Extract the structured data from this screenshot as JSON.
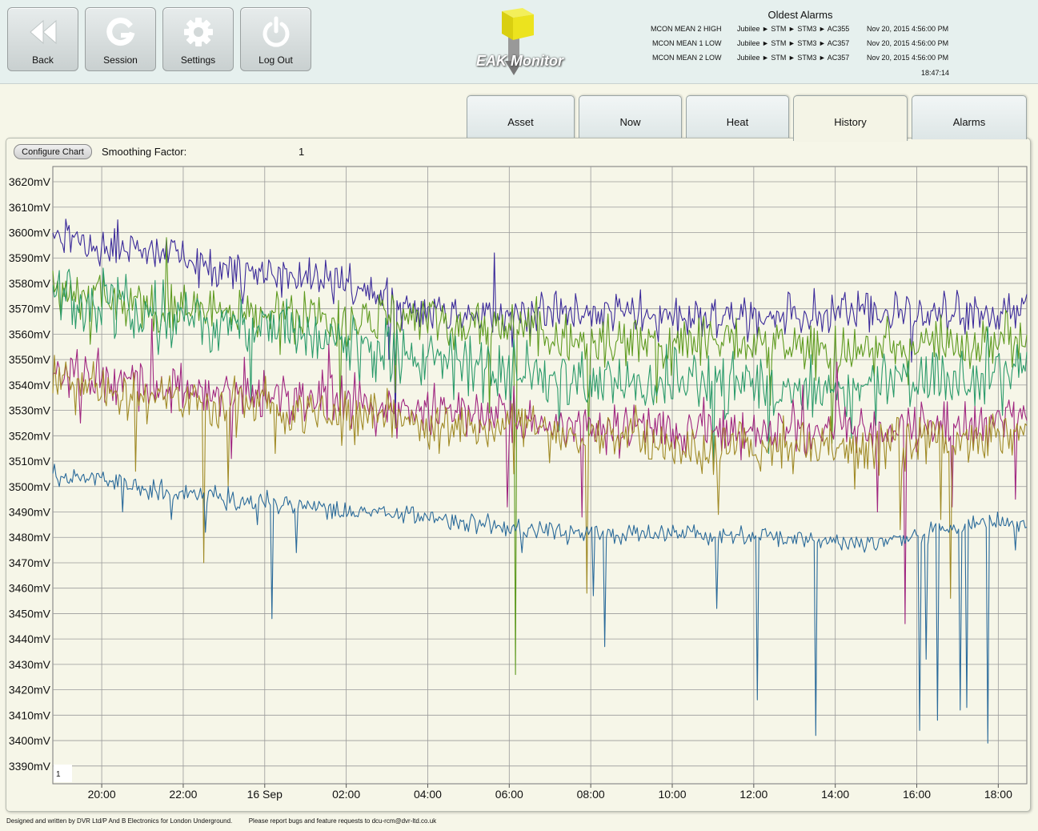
{
  "toolbar": {
    "back_label": "Back",
    "session_label": "Session",
    "settings_label": "Settings",
    "logout_label": "Log Out"
  },
  "logo": {
    "text": "EAK Monitor"
  },
  "alarms": {
    "title": "Oldest Alarms",
    "rows": [
      {
        "name": "MCON MEAN 2 HIGH",
        "path": "Jubilee ► STM ► STM3 ► AC355",
        "time": "Nov 20, 2015 4:56:00 PM"
      },
      {
        "name": "MCON MEAN 1 LOW",
        "path": "Jubilee ► STM ► STM3 ► AC357",
        "time": "Nov 20, 2015 4:56:00 PM"
      },
      {
        "name": "MCON MEAN 2 LOW",
        "path": "Jubilee ► STM ► STM3 ► AC357",
        "time": "Nov 20, 2015 4:56:00 PM"
      }
    ],
    "clock": "18:47:14"
  },
  "tabs": [
    {
      "label": "Asset"
    },
    {
      "label": "Now"
    },
    {
      "label": "Heat"
    },
    {
      "label": "History",
      "active": true
    },
    {
      "label": "Alarms"
    }
  ],
  "controls": {
    "configure_label": "Configure Chart",
    "smoothing_label": "Smoothing Factor:",
    "smoothing_value": "1"
  },
  "chart_data": {
    "type": "line",
    "y_unit": "mV",
    "ylim": [
      3383,
      3626
    ],
    "y_ticks": [
      "3620mV",
      "3610mV",
      "3600mV",
      "3590mV",
      "3580mV",
      "3570mV",
      "3560mV",
      "3550mV",
      "3540mV",
      "3530mV",
      "3520mV",
      "3510mV",
      "3500mV",
      "3490mV",
      "3480mV",
      "3470mV",
      "3460mV",
      "3450mV",
      "3440mV",
      "3430mV",
      "3420mV",
      "3410mV",
      "3400mV",
      "3390mV"
    ],
    "x_start": "18:48",
    "x_end": "18:42",
    "x_ticks": [
      "20:00",
      "22:00",
      "16 Sep",
      "02:00",
      "04:00",
      "06:00",
      "08:00",
      "10:00",
      "12:00",
      "14:00",
      "16:00",
      "18:00"
    ],
    "grid": true,
    "corner_label": "1",
    "colors": [
      "#3b2a9a",
      "#5e9a1f",
      "#2a9a6a",
      "#a02680",
      "#a08a26",
      "#2a6a9a"
    ],
    "series": [
      {
        "keypoints": [
          [
            0,
            3598
          ],
          [
            3,
            3595
          ],
          [
            6,
            3592
          ],
          [
            9,
            3588
          ],
          [
            12,
            3585
          ],
          [
            15,
            3583
          ],
          [
            18,
            3579
          ],
          [
            20,
            3574
          ],
          [
            22,
            3571
          ],
          [
            26,
            3568
          ],
          [
            30,
            3568
          ],
          [
            34,
            3568
          ],
          [
            38,
            3567
          ],
          [
            42,
            3567
          ],
          [
            46,
            3568
          ],
          [
            50,
            3568
          ],
          [
            54,
            3568
          ],
          [
            60,
            3568
          ]
        ],
        "noise": 4,
        "spikes": [
          [
            4,
            3605
          ],
          [
            8.5,
            3589
          ],
          [
            11.7,
            3572
          ],
          [
            14.5,
            3578
          ],
          [
            15.6,
            3585
          ],
          [
            20.7,
            3550
          ],
          [
            21.1,
            3523
          ],
          [
            23.0,
            3565
          ],
          [
            24.1,
            3572
          ],
          [
            27.2,
            3592
          ],
          [
            28.3,
            3555
          ],
          [
            31.3,
            3574
          ],
          [
            32.1,
            3563
          ],
          [
            34.9,
            3574
          ],
          [
            37.3,
            3557
          ],
          [
            42.8,
            3557
          ],
          [
            47.4,
            3561
          ],
          [
            52.9,
            3549
          ],
          [
            56.2,
            3560
          ]
        ]
      },
      {
        "keypoints": [
          [
            0,
            3577
          ],
          [
            5,
            3573
          ],
          [
            10,
            3568
          ],
          [
            15,
            3566
          ],
          [
            20,
            3565
          ],
          [
            25,
            3564
          ],
          [
            30,
            3561
          ],
          [
            32,
            3558
          ],
          [
            35,
            3557
          ],
          [
            40,
            3556
          ],
          [
            45,
            3555
          ],
          [
            50,
            3554
          ],
          [
            55,
            3556
          ],
          [
            60,
            3557
          ]
        ],
        "noise": 5,
        "spikes": [
          [
            2.3,
            3556
          ],
          [
            7.0,
            3598
          ],
          [
            9.7,
            3577
          ],
          [
            14.0,
            3552
          ],
          [
            17.7,
            3528
          ],
          [
            21.1,
            3537
          ],
          [
            23.4,
            3573
          ],
          [
            26.9,
            3529
          ],
          [
            28.5,
            3426
          ],
          [
            33.0,
            3520
          ],
          [
            37.2,
            3533
          ],
          [
            44.2,
            3532
          ],
          [
            48.0,
            3517
          ],
          [
            52.7,
            3540
          ],
          [
            58.8,
            3568
          ]
        ]
      },
      {
        "keypoints": [
          [
            0,
            3575
          ],
          [
            5,
            3570
          ],
          [
            10,
            3565
          ],
          [
            15,
            3560
          ],
          [
            18,
            3555
          ],
          [
            20,
            3552
          ],
          [
            25,
            3548
          ],
          [
            30,
            3543
          ],
          [
            35,
            3541
          ],
          [
            40,
            3540
          ],
          [
            45,
            3539
          ],
          [
            50,
            3540
          ],
          [
            55,
            3542
          ],
          [
            60,
            3546
          ]
        ],
        "noise": 6,
        "spikes": [
          [
            6.5,
            3552
          ],
          [
            12.2,
            3534
          ],
          [
            17.1,
            3564
          ],
          [
            18.9,
            3540
          ],
          [
            26.5,
            3533
          ],
          [
            31.2,
            3522
          ],
          [
            37.8,
            3556
          ],
          [
            40.7,
            3506
          ],
          [
            44.1,
            3513
          ],
          [
            49.2,
            3519
          ],
          [
            53.5,
            3551
          ],
          [
            57.6,
            3563
          ]
        ]
      },
      {
        "keypoints": [
          [
            0,
            3545
          ],
          [
            5,
            3541
          ],
          [
            10,
            3538
          ],
          [
            15,
            3535
          ],
          [
            20,
            3532
          ],
          [
            25,
            3529
          ],
          [
            30,
            3526
          ],
          [
            35,
            3524
          ],
          [
            40,
            3522
          ],
          [
            45,
            3522
          ],
          [
            50,
            3523
          ],
          [
            55,
            3525
          ],
          [
            60,
            3527
          ]
        ],
        "noise": 5,
        "spikes": [
          [
            1.7,
            3525
          ],
          [
            6.1,
            3566
          ],
          [
            11.0,
            3511
          ],
          [
            17.0,
            3556
          ],
          [
            21.2,
            3519
          ],
          [
            28.0,
            3492
          ],
          [
            32.6,
            3488
          ],
          [
            37.3,
            3528
          ],
          [
            41.7,
            3518
          ],
          [
            46.2,
            3540
          ],
          [
            48.3,
            3549
          ],
          [
            50.8,
            3490
          ],
          [
            52.5,
            3446
          ],
          [
            55.4,
            3492
          ],
          [
            59.3,
            3495
          ]
        ]
      },
      {
        "keypoints": [
          [
            0,
            3542
          ],
          [
            5,
            3537
          ],
          [
            10,
            3533
          ],
          [
            15,
            3530
          ],
          [
            20,
            3528
          ],
          [
            25,
            3524
          ],
          [
            30,
            3521
          ],
          [
            35,
            3518
          ],
          [
            40,
            3516
          ],
          [
            45,
            3515
          ],
          [
            50,
            3517
          ],
          [
            55,
            3519
          ],
          [
            60,
            3522
          ]
        ],
        "noise": 5,
        "spikes": [
          [
            5.1,
            3506
          ],
          [
            9.3,
            3470
          ],
          [
            10.8,
            3500
          ],
          [
            13.7,
            3513
          ],
          [
            19.4,
            3525
          ],
          [
            23.8,
            3513
          ],
          [
            28.4,
            3505
          ],
          [
            32.9,
            3458
          ],
          [
            35.9,
            3532
          ],
          [
            41.0,
            3489
          ],
          [
            45.6,
            3505
          ],
          [
            49.4,
            3499
          ],
          [
            52.2,
            3483
          ],
          [
            54.7,
            3487
          ],
          [
            55.3,
            3456
          ],
          [
            58.9,
            3515
          ]
        ]
      },
      {
        "keypoints": [
          [
            0,
            3505
          ],
          [
            4,
            3501
          ],
          [
            8,
            3497
          ],
          [
            12,
            3494
          ],
          [
            16,
            3492
          ],
          [
            20,
            3490
          ],
          [
            25,
            3487
          ],
          [
            28,
            3484
          ],
          [
            30,
            3483
          ],
          [
            35,
            3481
          ],
          [
            40,
            3481
          ],
          [
            45,
            3480
          ],
          [
            50,
            3478
          ],
          [
            53,
            3480
          ],
          [
            55,
            3483
          ],
          [
            58,
            3486
          ],
          [
            60,
            3486
          ]
        ],
        "noise": 2,
        "spikes": [
          [
            4.3,
            3490
          ],
          [
            7.3,
            3487
          ],
          [
            9.4,
            3482
          ],
          [
            12.6,
            3485
          ],
          [
            13.5,
            3448
          ],
          [
            15.0,
            3474
          ],
          [
            28.4,
            3485
          ],
          [
            28.9,
            3474
          ],
          [
            33.3,
            3457
          ],
          [
            34.0,
            3437
          ],
          [
            40.9,
            3452
          ],
          [
            43.4,
            3416
          ],
          [
            47.0,
            3402
          ],
          [
            53.4,
            3404
          ],
          [
            53.8,
            3432
          ],
          [
            54.5,
            3408
          ],
          [
            55.9,
            3412
          ],
          [
            56.3,
            3413
          ],
          [
            57.6,
            3399
          ],
          [
            59.3,
            3475
          ]
        ]
      }
    ]
  },
  "footer": {
    "credit": "Designed and written by DVR Ltd/P And B Electronics for London Underground.",
    "report": "Please report bugs and feature requests to dcu-rcm@dvr-ltd.co.uk"
  }
}
